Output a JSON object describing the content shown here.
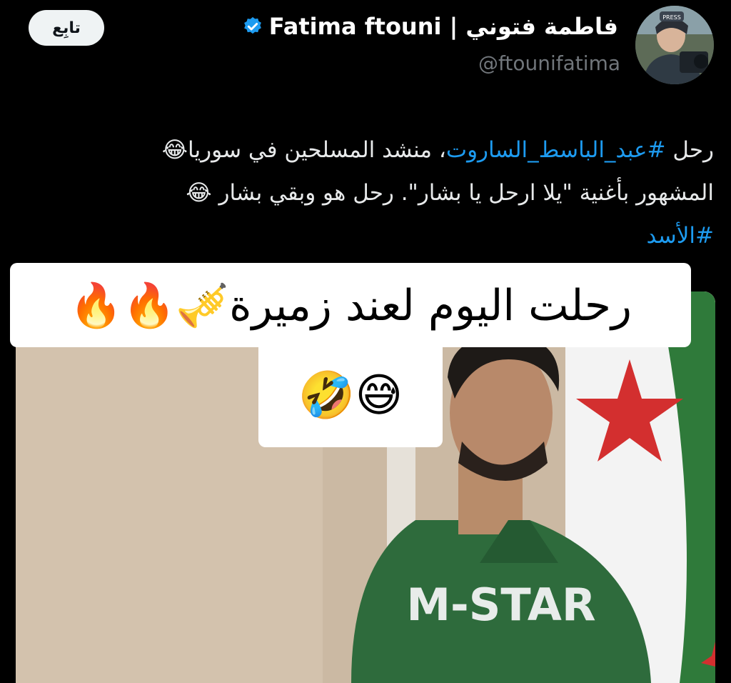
{
  "header": {
    "follow_label": "تابِع",
    "display_name": "Fatima ftouni | فاطمة فتوني",
    "handle": "@ftounifatima",
    "avatar_label": "PRESS"
  },
  "tweet": {
    "line1_prefix": "رحل ",
    "hashtag1": "#عبد_الباسط_الساروت",
    "line1_suffix": "، منشد المسلحين في سوريا😂",
    "line2": "المشهور بأغنية \"يلا ارحل يا بشار\". رحل هو وبقي بشار 😂",
    "hashtag2": "#الأسد"
  },
  "media": {
    "caption_top": "رحلت اليوم لعند زميرة🎺🔥🔥",
    "caption_bottom": "😅🤣",
    "shirt_text": "M-STAR"
  },
  "colors": {
    "accent": "#1d9bf0",
    "background": "#000000",
    "flag_green": "#2f7a3a",
    "flag_red": "#d32f2f"
  }
}
